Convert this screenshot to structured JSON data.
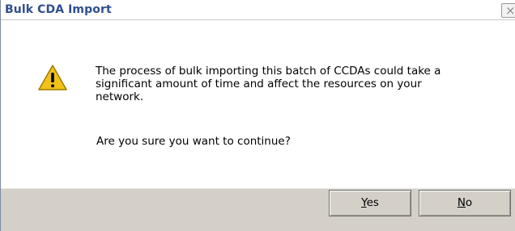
{
  "window": {
    "title": "Bulk CDA Import",
    "close_glyph": "×"
  },
  "icon": {
    "name": "warning-icon",
    "colors": {
      "fill": "#f2c21a",
      "border": "#a07a00",
      "mark": "#000000"
    }
  },
  "message": {
    "lines": [
      "The process of bulk importing this batch of CCDAs could take a",
      "significant amount of time and affect the resources on your",
      "network."
    ],
    "question": "Are you sure you want to continue?"
  },
  "buttons": {
    "yes": {
      "accel": "Y",
      "rest": "es"
    },
    "no": {
      "accel": "N",
      "rest": "o"
    }
  }
}
